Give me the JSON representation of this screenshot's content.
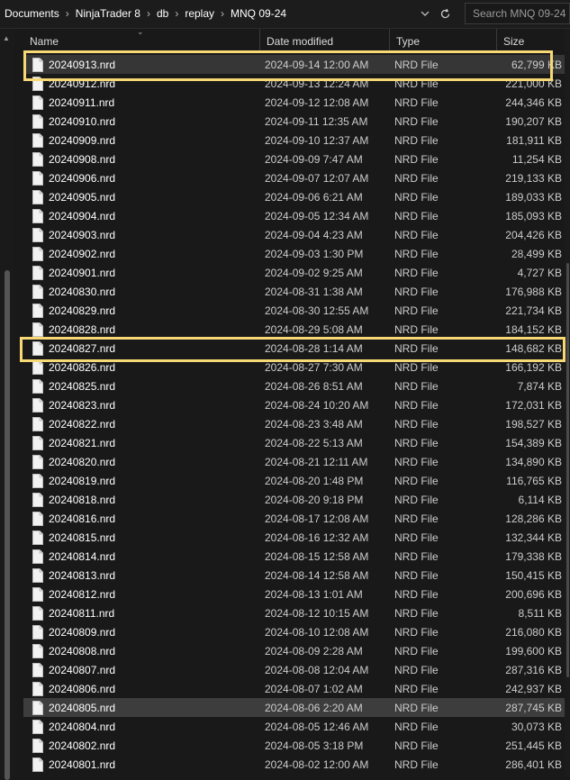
{
  "address": {
    "crumbs": [
      "Documents",
      "NinjaTrader 8",
      "db",
      "replay",
      "MNQ 09-24"
    ],
    "separator": "›",
    "search_placeholder": "Search MNQ 09-24"
  },
  "columns": {
    "name": "Name",
    "date": "Date modified",
    "type": "Type",
    "size": "Size"
  },
  "highlight_color": "#f6d874",
  "files": [
    {
      "name": "20240913.nrd",
      "date": "2024-09-14 12:00 AM",
      "type": "NRD File",
      "size": "62,799 KB",
      "state": "selected"
    },
    {
      "name": "20240912.nrd",
      "date": "2024-09-13 12:24 AM",
      "type": "NRD File",
      "size": "221,000 KB"
    },
    {
      "name": "20240911.nrd",
      "date": "2024-09-12 12:08 AM",
      "type": "NRD File",
      "size": "244,346 KB"
    },
    {
      "name": "20240910.nrd",
      "date": "2024-09-11 12:35 AM",
      "type": "NRD File",
      "size": "190,207 KB"
    },
    {
      "name": "20240909.nrd",
      "date": "2024-09-10 12:37 AM",
      "type": "NRD File",
      "size": "181,911 KB"
    },
    {
      "name": "20240908.nrd",
      "date": "2024-09-09 7:47 AM",
      "type": "NRD File",
      "size": "11,254 KB"
    },
    {
      "name": "20240906.nrd",
      "date": "2024-09-07 12:07 AM",
      "type": "NRD File",
      "size": "219,133 KB"
    },
    {
      "name": "20240905.nrd",
      "date": "2024-09-06 6:21 AM",
      "type": "NRD File",
      "size": "189,033 KB"
    },
    {
      "name": "20240904.nrd",
      "date": "2024-09-05 12:34 AM",
      "type": "NRD File",
      "size": "185,093 KB"
    },
    {
      "name": "20240903.nrd",
      "date": "2024-09-04 4:23 AM",
      "type": "NRD File",
      "size": "204,426 KB"
    },
    {
      "name": "20240902.nrd",
      "date": "2024-09-03 1:30 PM",
      "type": "NRD File",
      "size": "28,499 KB"
    },
    {
      "name": "20240901.nrd",
      "date": "2024-09-02 9:25 AM",
      "type": "NRD File",
      "size": "4,727 KB"
    },
    {
      "name": "20240830.nrd",
      "date": "2024-08-31 1:38 AM",
      "type": "NRD File",
      "size": "176,988 KB"
    },
    {
      "name": "20240829.nrd",
      "date": "2024-08-30 12:55 AM",
      "type": "NRD File",
      "size": "221,734 KB"
    },
    {
      "name": "20240828.nrd",
      "date": "2024-08-29 5:08 AM",
      "type": "NRD File",
      "size": "184,152 KB"
    },
    {
      "name": "20240827.nrd",
      "date": "2024-08-28 1:14 AM",
      "type": "NRD File",
      "size": "148,682 KB"
    },
    {
      "name": "20240826.nrd",
      "date": "2024-08-27 7:30 AM",
      "type": "NRD File",
      "size": "166,192 KB"
    },
    {
      "name": "20240825.nrd",
      "date": "2024-08-26 8:51 AM",
      "type": "NRD File",
      "size": "7,874 KB"
    },
    {
      "name": "20240823.nrd",
      "date": "2024-08-24 10:20 AM",
      "type": "NRD File",
      "size": "172,031 KB"
    },
    {
      "name": "20240822.nrd",
      "date": "2024-08-23 3:48 AM",
      "type": "NRD File",
      "size": "198,527 KB"
    },
    {
      "name": "20240821.nrd",
      "date": "2024-08-22 5:13 AM",
      "type": "NRD File",
      "size": "154,389 KB"
    },
    {
      "name": "20240820.nrd",
      "date": "2024-08-21 12:11 AM",
      "type": "NRD File",
      "size": "134,890 KB"
    },
    {
      "name": "20240819.nrd",
      "date": "2024-08-20 1:48 PM",
      "type": "NRD File",
      "size": "116,765 KB"
    },
    {
      "name": "20240818.nrd",
      "date": "2024-08-20 9:18 PM",
      "type": "NRD File",
      "size": "6,114 KB"
    },
    {
      "name": "20240816.nrd",
      "date": "2024-08-17 12:08 AM",
      "type": "NRD File",
      "size": "128,286 KB"
    },
    {
      "name": "20240815.nrd",
      "date": "2024-08-16 12:32 AM",
      "type": "NRD File",
      "size": "132,344 KB"
    },
    {
      "name": "20240814.nrd",
      "date": "2024-08-15 12:58 AM",
      "type": "NRD File",
      "size": "179,338 KB"
    },
    {
      "name": "20240813.nrd",
      "date": "2024-08-14 12:58 AM",
      "type": "NRD File",
      "size": "150,415 KB"
    },
    {
      "name": "20240812.nrd",
      "date": "2024-08-13 1:01 AM",
      "type": "NRD File",
      "size": "200,696 KB"
    },
    {
      "name": "20240811.nrd",
      "date": "2024-08-12 10:15 AM",
      "type": "NRD File",
      "size": "8,511 KB"
    },
    {
      "name": "20240809.nrd",
      "date": "2024-08-10 12:08 AM",
      "type": "NRD File",
      "size": "216,080 KB"
    },
    {
      "name": "20240808.nrd",
      "date": "2024-08-09 2:28 AM",
      "type": "NRD File",
      "size": "199,600 KB"
    },
    {
      "name": "20240807.nrd",
      "date": "2024-08-08 12:04 AM",
      "type": "NRD File",
      "size": "287,316 KB"
    },
    {
      "name": "20240806.nrd",
      "date": "2024-08-07 1:02 AM",
      "type": "NRD File",
      "size": "242,937 KB"
    },
    {
      "name": "20240805.nrd",
      "date": "2024-08-06 2:20 AM",
      "type": "NRD File",
      "size": "287,745 KB",
      "state": "hovered"
    },
    {
      "name": "20240804.nrd",
      "date": "2024-08-05 12:46 AM",
      "type": "NRD File",
      "size": "30,073 KB"
    },
    {
      "name": "20240802.nrd",
      "date": "2024-08-05 3:18 PM",
      "type": "NRD File",
      "size": "251,445 KB"
    },
    {
      "name": "20240801.nrd",
      "date": "2024-08-02 12:00 AM",
      "type": "NRD File",
      "size": "286,401 KB"
    }
  ]
}
